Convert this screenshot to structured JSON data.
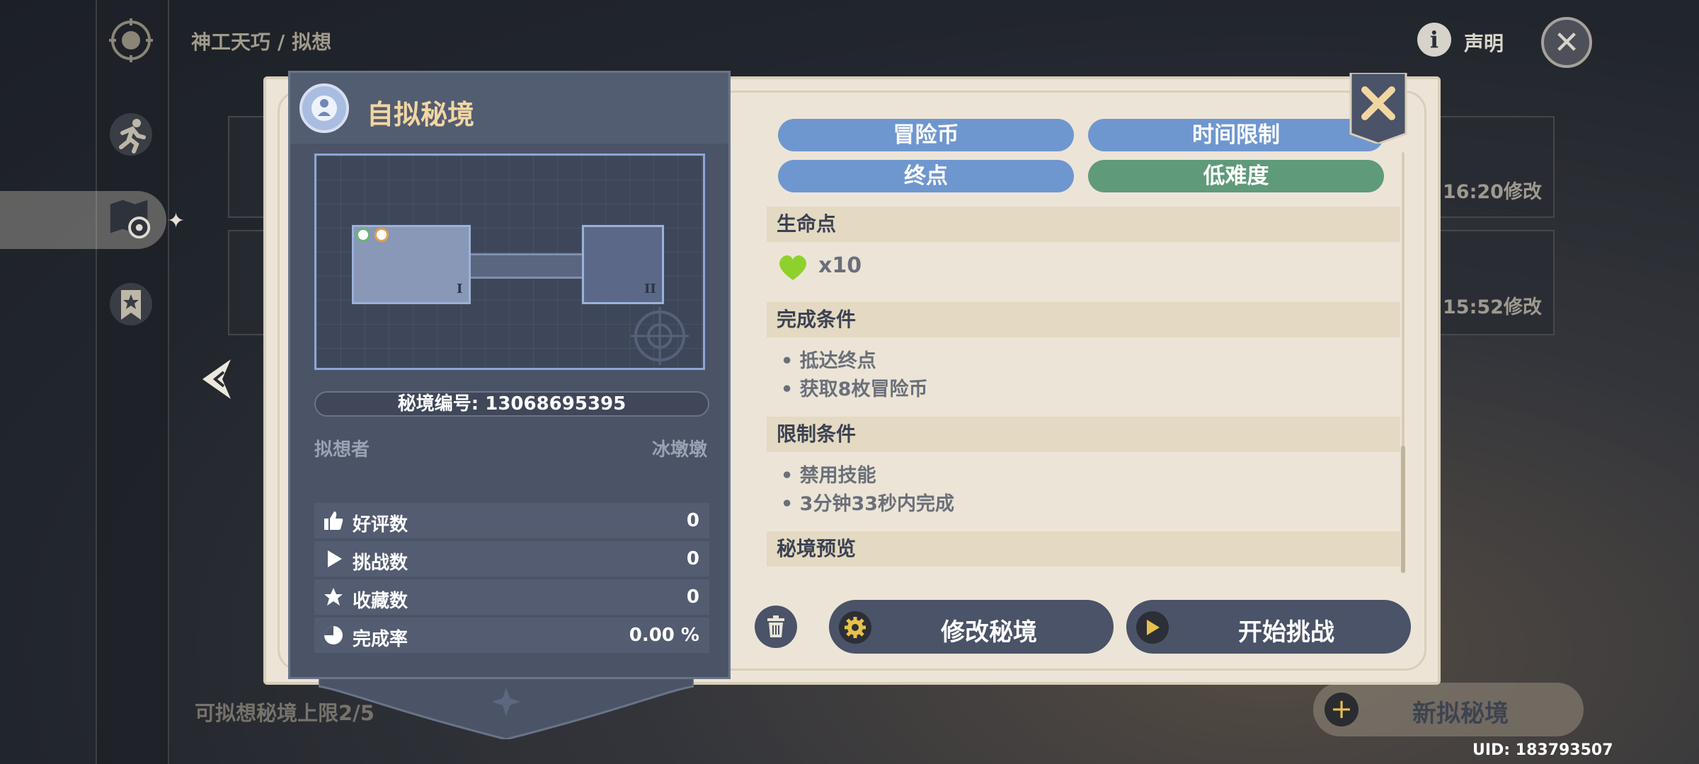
{
  "breadcrumb": {
    "part1": "神工天巧",
    "sep": "/",
    "part2": "拟想"
  },
  "topbar": {
    "info_label": "声明"
  },
  "background_cards": {
    "time1": "16:20修改",
    "time2": "15:52修改"
  },
  "footer": {
    "limit_text": "可拟想秘境上限2/5",
    "new_button": "新拟秘境",
    "uid": "UID: 183793507"
  },
  "panel": {
    "title": "自拟秘境",
    "code": "秘境编号: 13068695395",
    "creator_label": "拟想者",
    "creator_name": "冰墩墩",
    "stats": [
      {
        "icon": "thumbs-up-icon",
        "label": "好评数",
        "value": "0"
      },
      {
        "icon": "play-icon",
        "label": "挑战数",
        "value": "0"
      },
      {
        "icon": "star-icon",
        "label": "收藏数",
        "value": "0"
      },
      {
        "icon": "pie-chart-icon",
        "label": "完成率",
        "value": "0.00 %"
      }
    ]
  },
  "tags": [
    {
      "label": "冒险币",
      "color": "#6f97cf"
    },
    {
      "label": "时间限制",
      "color": "#6f97cf"
    },
    {
      "label": "终点",
      "color": "#6f97cf"
    },
    {
      "label": "低难度",
      "color": "#5f9a7a"
    }
  ],
  "sections": {
    "hp": {
      "title": "生命点",
      "value": "x10"
    },
    "completion": {
      "title": "完成条件",
      "items": [
        "抵达终点",
        "获取8枚冒险币"
      ]
    },
    "restriction": {
      "title": "限制条件",
      "items": [
        "禁用技能",
        "3分钟33秒内完成"
      ]
    },
    "preview": {
      "title": "秘境预览"
    }
  },
  "actions": {
    "modify": "修改秘境",
    "start": "开始挑战"
  },
  "colors": {
    "panel": "#4b5467",
    "dialog": "#ece5d7",
    "title_gold": "#f2d6a2",
    "heart_green": "#8fd12c"
  }
}
